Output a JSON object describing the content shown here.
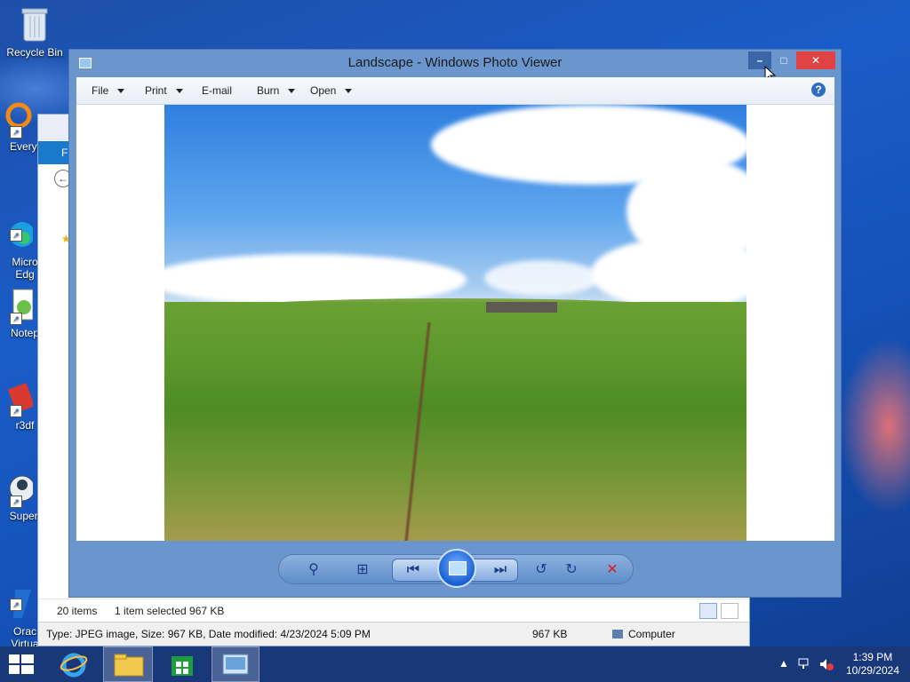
{
  "desktop": {
    "icons": [
      {
        "label": "Recycle Bin"
      },
      {
        "label": "Everyt"
      },
      {
        "label": "Micro\nEdg"
      },
      {
        "label": "Notep"
      },
      {
        "label": "r3df"
      },
      {
        "label": "Superl"
      },
      {
        "label": "Orac\nVirtua"
      }
    ]
  },
  "explorer": {
    "ribbon_tab": "Fi",
    "status": {
      "items": "20 items",
      "selected": "1 item selected  967 KB"
    },
    "info": {
      "details": "Type: JPEG image, Size: 967 KB, Date modified: 4/23/2024 5:09 PM",
      "size": "967 KB",
      "location": "Computer"
    }
  },
  "photo_viewer": {
    "title": "Landscape - Windows Photo Viewer",
    "window_buttons": {
      "minimize": "–",
      "maximize": "□",
      "close": "✕"
    },
    "menu": [
      {
        "label": "File",
        "has_caret": true
      },
      {
        "label": "Print",
        "has_caret": true
      },
      {
        "label": "E-mail",
        "has_caret": false
      },
      {
        "label": "Burn",
        "has_caret": true
      },
      {
        "label": "Open",
        "has_caret": true
      }
    ],
    "help": "?",
    "controls": {
      "zoom": "⚲",
      "actual_size": "⊞",
      "previous": "⏮",
      "next": "⏭",
      "rotate_ccw": "↺",
      "rotate_cw": "↻",
      "delete": "✕"
    }
  },
  "taskbar": {
    "time": "1:39 PM",
    "date": "10/29/2024",
    "show_hidden": "▲"
  },
  "colors": {
    "desktop": "#1a5cc8",
    "viewer_frame": "#6a95cd",
    "close_button": "#e04343",
    "taskbar": "#18387a"
  }
}
